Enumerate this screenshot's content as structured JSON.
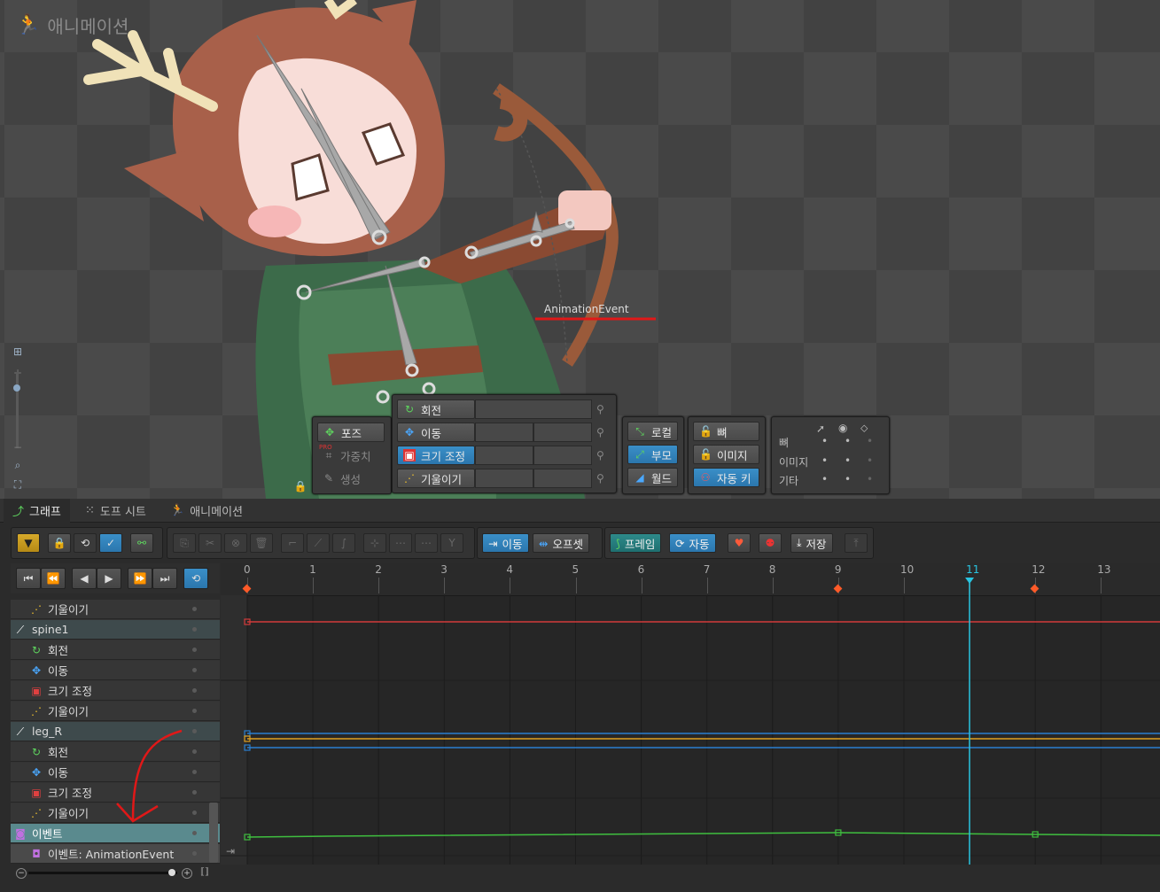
{
  "viewport": {
    "mode_title": "애니메이션",
    "event_label": "AnimationEvent"
  },
  "transform_panel": {
    "left_buttons": [
      {
        "label": "포즈",
        "selected": false
      },
      {
        "label": "가중치",
        "selected": false,
        "disabled": true,
        "badge": "PRO"
      },
      {
        "label": "생성",
        "selected": false,
        "disabled": true
      }
    ],
    "rows": [
      {
        "label": "회전",
        "icon": "rotate-icon",
        "selected": false
      },
      {
        "label": "이동",
        "icon": "translate-icon",
        "selected": false
      },
      {
        "label": "크기 조정",
        "icon": "scale-icon",
        "selected": true
      },
      {
        "label": "기울이기",
        "icon": "shear-icon",
        "selected": false
      }
    ]
  },
  "axes_panel": {
    "buttons": [
      {
        "label": "로컬",
        "selected": false
      },
      {
        "label": "부모",
        "selected": true
      },
      {
        "label": "월드",
        "selected": false
      }
    ]
  },
  "options_panel": {
    "buttons": [
      {
        "label": "뼈",
        "selected": false
      },
      {
        "label": "이미지",
        "selected": false
      },
      {
        "label": "자동 키",
        "selected": true
      }
    ]
  },
  "visibility_panel": {
    "rows": [
      "뼈",
      "이미지",
      "기타"
    ]
  },
  "tabs": [
    {
      "label": "그래프",
      "active": true
    },
    {
      "label": "도프 시트",
      "active": false
    },
    {
      "label": "애니메이션",
      "active": false
    }
  ],
  "toolbar": {
    "move_label": "이동",
    "offset_label": "오프셋",
    "frames_label": "프레임",
    "auto_label": "자동",
    "save_label": "저장"
  },
  "tree": {
    "rows": [
      {
        "label": "기울이기",
        "icon": "shear-icon",
        "type": "prop"
      },
      {
        "label": "spine1",
        "icon": "bone-icon",
        "type": "bone"
      },
      {
        "label": "회전",
        "icon": "rotate-icon",
        "type": "prop"
      },
      {
        "label": "이동",
        "icon": "translate-icon",
        "type": "prop"
      },
      {
        "label": "크기 조정",
        "icon": "scale-icon",
        "type": "prop"
      },
      {
        "label": "기울이기",
        "icon": "shear-icon",
        "type": "prop"
      },
      {
        "label": "leg_R",
        "icon": "bone-icon",
        "type": "bone"
      },
      {
        "label": "회전",
        "icon": "rotate-icon",
        "type": "prop"
      },
      {
        "label": "이동",
        "icon": "translate-icon",
        "type": "prop"
      },
      {
        "label": "크기 조정",
        "icon": "scale-icon",
        "type": "prop"
      },
      {
        "label": "기울이기",
        "icon": "shear-icon",
        "type": "prop"
      },
      {
        "label": "이벤트",
        "icon": "event-icon",
        "type": "event-selected"
      },
      {
        "label": "이벤트: AnimationEvent",
        "icon": "event-item-icon",
        "type": "event"
      }
    ]
  },
  "timeline": {
    "frames": [
      "0",
      "1",
      "2",
      "3",
      "4",
      "5",
      "6",
      "7",
      "8",
      "9",
      "10",
      "11",
      "12",
      "13"
    ],
    "current_frame": "11",
    "keyframes": [
      "0",
      "9",
      "12"
    ]
  },
  "colors": {
    "accent": "#2b76ad",
    "playhead": "#29c4e0",
    "curve_green": "#3fbf3f",
    "curve_red": "#d23a3a",
    "curve_orange": "#e0a020",
    "curve_blue": "#2a7fd0",
    "annotation_red": "#e01818"
  }
}
